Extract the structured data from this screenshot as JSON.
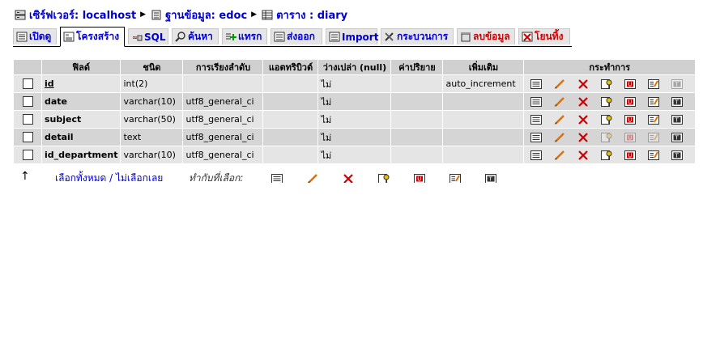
{
  "breadcrumb": {
    "server_label": "เซิร์ฟเวอร์: localhost",
    "database_label": "ฐานข้อมูล: edoc",
    "table_label": "ตาราง : diary"
  },
  "tabs": [
    {
      "label": "เปิดดู",
      "icon": "browse-icon"
    },
    {
      "label": "โครงสร้าง",
      "icon": "structure-icon"
    },
    {
      "label": "SQL",
      "icon": "sql-icon"
    },
    {
      "label": "ค้นหา",
      "icon": "search-icon"
    },
    {
      "label": "แทรก",
      "icon": "insert-icon"
    },
    {
      "label": "ส่งออก",
      "icon": "export-icon"
    },
    {
      "label": "Import",
      "icon": "import-icon"
    },
    {
      "label": "กระบวนการ",
      "icon": "operations-icon"
    },
    {
      "label": "ลบข้อมูล",
      "icon": "empty-icon"
    },
    {
      "label": "โยนทิ้ง",
      "icon": "drop-icon"
    }
  ],
  "table": {
    "headers": [
      "ฟิลด์",
      "ชนิด",
      "การเรียงลำดับ",
      "แอตทริบิวต์",
      "ว่างเปล่า (null)",
      "ค่าปริยาย",
      "เพิ่มเติม",
      "กระทำการ"
    ],
    "rows": [
      {
        "field": "id",
        "type": "int(2)",
        "collation": "",
        "attributes": "",
        "null": "ไม่",
        "default": "",
        "extra": "auto_increment"
      },
      {
        "field": "date",
        "type": "varchar(10)",
        "collation": "utf8_general_ci",
        "attributes": "",
        "null": "ไม่",
        "default": "",
        "extra": ""
      },
      {
        "field": "subject",
        "type": "varchar(50)",
        "collation": "utf8_general_ci",
        "attributes": "",
        "null": "ไม่",
        "default": "",
        "extra": ""
      },
      {
        "field": "detail",
        "type": "text",
        "collation": "utf8_general_ci",
        "attributes": "",
        "null": "ไม่",
        "default": "",
        "extra": ""
      },
      {
        "field": "id_department",
        "type": "varchar(10)",
        "collation": "utf8_general_ci",
        "attributes": "",
        "null": "ไม่",
        "default": "",
        "extra": ""
      }
    ]
  },
  "footer": {
    "arrow": "↑",
    "select_links": "เลือกทั้งหมด / ไม่เลือกเลย",
    "with_selected": "ทำกับที่เลือก:"
  },
  "colors": {
    "link": "#0000cc",
    "danger": "#cc0000",
    "header_bg": "#d0d0d0",
    "row_odd": "#e5e5e5",
    "row_even": "#d5d5d5"
  }
}
